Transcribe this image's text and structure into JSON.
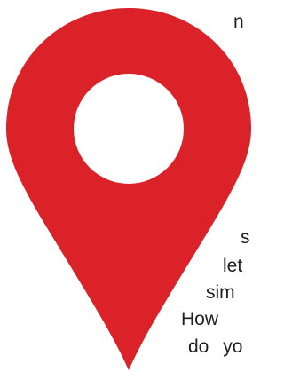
{
  "colors": {
    "pin": "#db2229",
    "hole": "#ffffff",
    "text": "#1f1f1f",
    "background": "#ffffff"
  },
  "icon": "map-pin-icon",
  "text_fragments": [
    "n",
    "s",
    "let",
    "sim",
    "How",
    "do yo"
  ]
}
